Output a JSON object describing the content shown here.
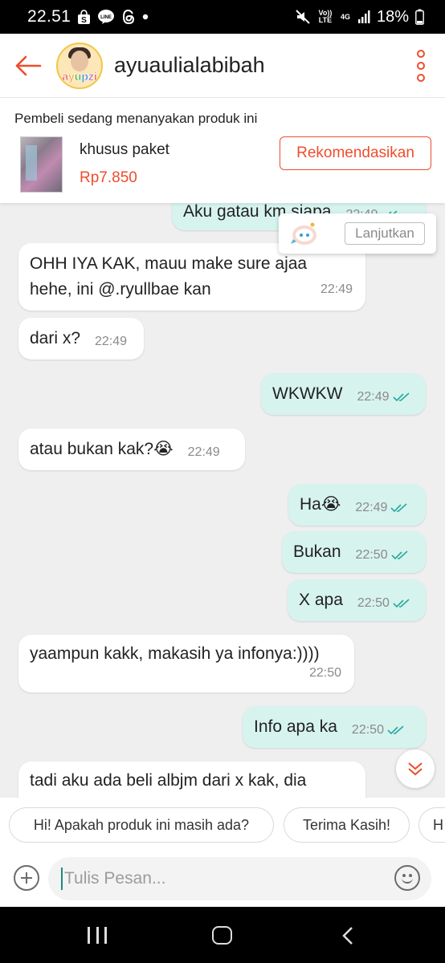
{
  "status_bar": {
    "time": "22.51",
    "battery": "18%",
    "icons": [
      "shopee-notification-icon",
      "line-icon",
      "threads-icon",
      "dot-icon",
      "mute-icon",
      "volte-icon",
      "4g-icon",
      "signal-icon",
      "battery-icon"
    ],
    "volte_label": "Vo)) LTE",
    "network_label": "4G"
  },
  "header": {
    "username": "ayuaulialabibah",
    "avatar_text": "ayupzi"
  },
  "product": {
    "notice": "Pembeli sedang menanyakan produk ini",
    "name": "khusus paket",
    "price": "Rp7.850",
    "recommend_label": "Rekomendasikan"
  },
  "continue_popup": {
    "label": "Lanjutkan"
  },
  "messages": [
    {
      "dir": "out",
      "text": "Aku gatau km siapa",
      "time": "22:49",
      "read": true
    },
    {
      "dir": "in",
      "text": "OHH IYA KAK, mauu make sure ajaa hehe, ini @.ryullbae kan",
      "time": "22:49"
    },
    {
      "dir": "in",
      "text": "dari x?",
      "time": "22:49"
    },
    {
      "dir": "out",
      "text": "WKWKW",
      "time": "22:49",
      "read": true
    },
    {
      "dir": "in",
      "text": "atau bukan kak?😭",
      "time": "22:49"
    },
    {
      "dir": "out",
      "text": "Ha😭",
      "time": "22:49",
      "read": true
    },
    {
      "dir": "out",
      "text": "Bukan",
      "time": "22:50",
      "read": true
    },
    {
      "dir": "out",
      "text": "X apa",
      "time": "22:50",
      "read": true
    },
    {
      "dir": "in",
      "text": "yaampun kakk, makasih ya infonya:))))",
      "time": "22:50"
    },
    {
      "dir": "out",
      "text": "Info apa ka",
      "time": "22:50",
      "read": true
    },
    {
      "dir": "in",
      "text": "tadi aku ada beli albjm dari x kak, dia",
      "time": ""
    }
  ],
  "quick_replies": [
    "Hi! Apakah produk ini masih ada?",
    "Terima Kasih!",
    "H"
  ],
  "input": {
    "placeholder": "Tulis Pesan..."
  },
  "colors": {
    "accent": "#ee4d2d",
    "outgoing_bubble": "#d7f3ee",
    "incoming_bubble": "#ffffff",
    "read_tick": "#2aa6a0"
  }
}
